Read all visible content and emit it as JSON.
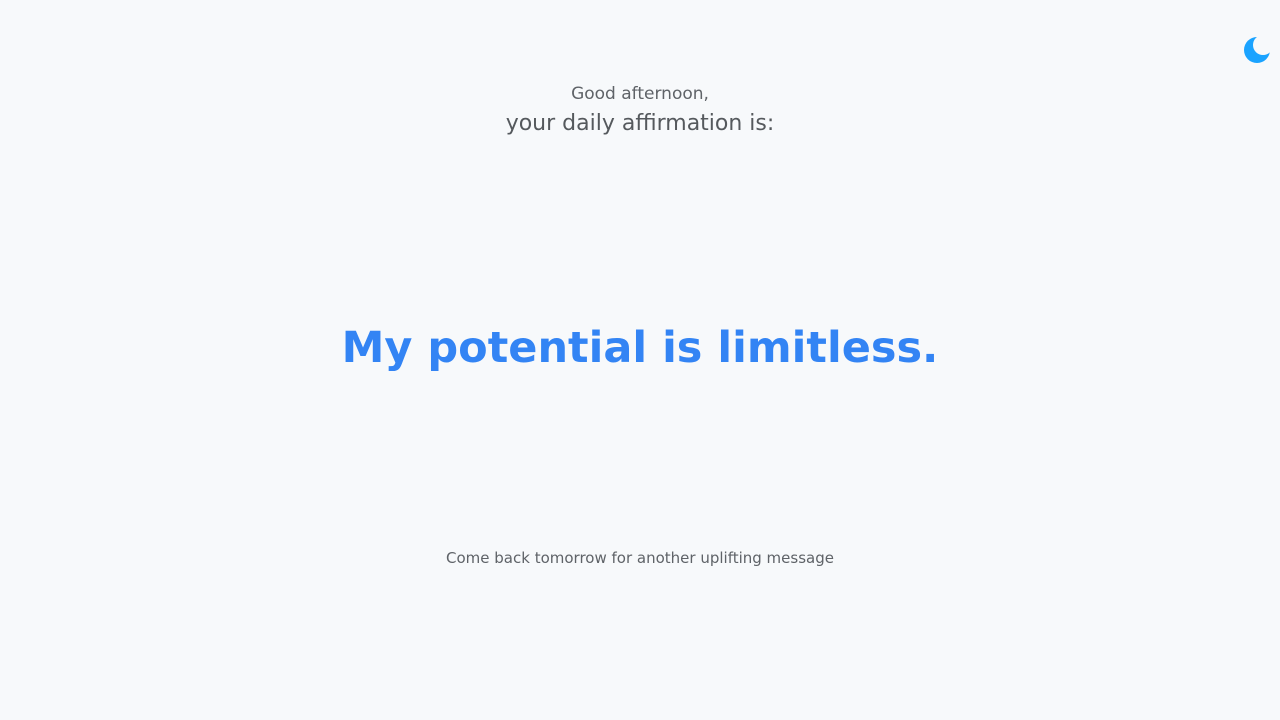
{
  "header": {
    "theme_toggle_icon": "moon-icon",
    "accent_color": "#1aa3ff"
  },
  "greeting": {
    "line1": "Good afternoon,",
    "line2": "your daily affirmation is:"
  },
  "affirmation": {
    "text": "My potential is limitless.",
    "color": "#3384f4"
  },
  "footer": {
    "message": "Come back tomorrow for another uplifting message"
  }
}
